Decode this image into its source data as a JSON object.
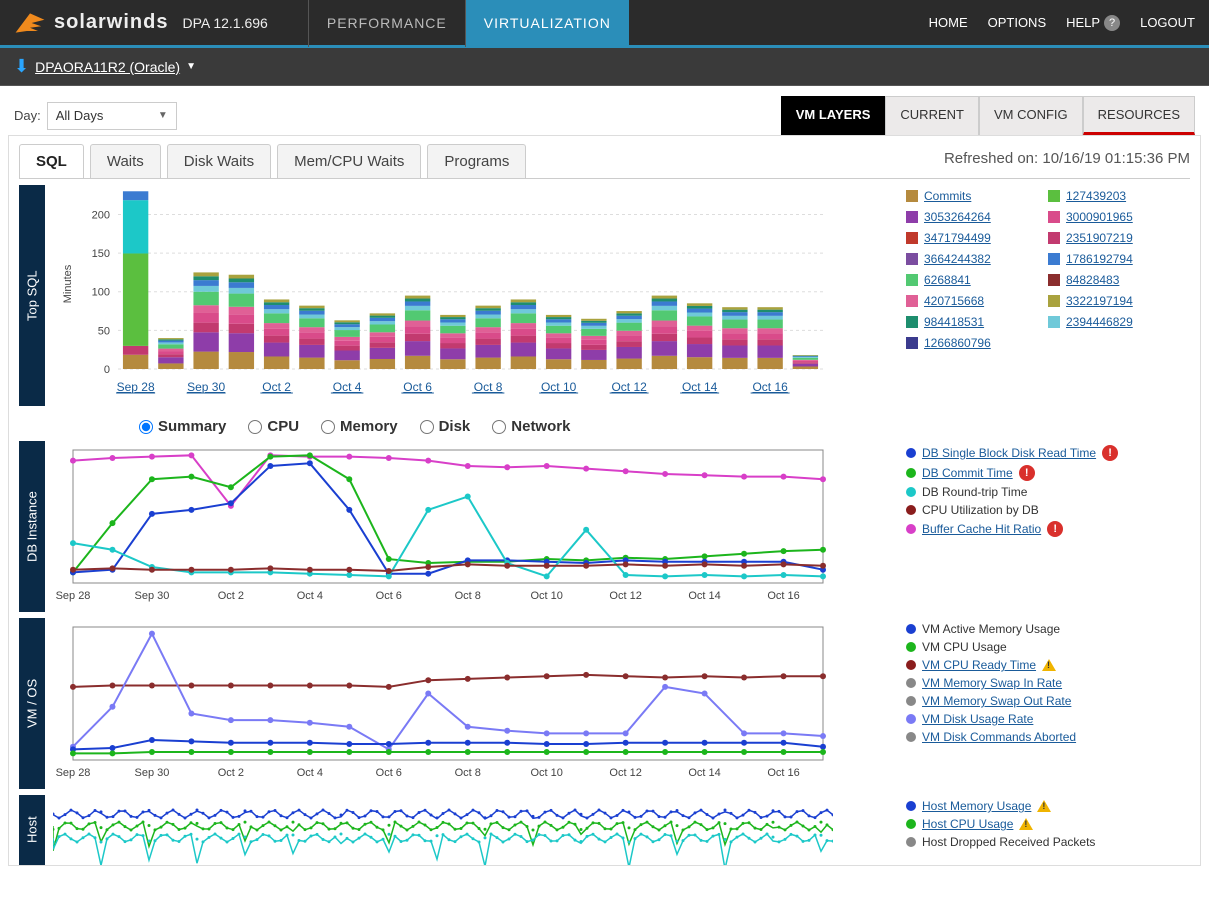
{
  "header": {
    "brand": "solarwinds",
    "product": "DPA 12.1.696",
    "nav": {
      "home": "HOME",
      "options": "OPTIONS",
      "help": "HELP",
      "logout": "LOGOUT"
    },
    "main_tabs": {
      "performance": "PERFORMANCE",
      "virtualization": "VIRTUALIZATION"
    }
  },
  "subheader": {
    "db_name": "DPAORA11R2 (Oracle)"
  },
  "toolbar": {
    "day_label": "Day:",
    "day_value": "All Days",
    "vm_tabs": {
      "layers": "VM LAYERS",
      "current": "CURRENT",
      "config": "VM CONFIG",
      "resources": "RESOURCES"
    }
  },
  "chart_tabs": {
    "sql": "SQL",
    "waits": "Waits",
    "disk_waits": "Disk Waits",
    "mem_cpu": "Mem/CPU Waits",
    "programs": "Programs"
  },
  "refreshed": {
    "label": "Refreshed on:",
    "value": "10/16/19 01:15:36 PM"
  },
  "view_radios": {
    "summary": "Summary",
    "cpu": "CPU",
    "memory": "Memory",
    "disk": "Disk",
    "network": "Network"
  },
  "panels": {
    "top_sql": "Top SQL",
    "db_instance": "DB Instance",
    "vm_os": "VM / OS",
    "host": "Host"
  },
  "top_sql_legend": [
    {
      "label": "Commits",
      "color": "#b58a3e"
    },
    {
      "label": "127439203",
      "color": "#5bbf3f"
    },
    {
      "label": "3053264264",
      "color": "#8e3da9"
    },
    {
      "label": "3000901965",
      "color": "#d94b8a"
    },
    {
      "label": "3471794499",
      "color": "#c0392b"
    },
    {
      "label": "2351907219",
      "color": "#c23a6f"
    },
    {
      "label": "3664244382",
      "color": "#7b4da0"
    },
    {
      "label": "1786192794",
      "color": "#3b7bd1"
    },
    {
      "label": "6268841",
      "color": "#52c972"
    },
    {
      "label": "84828483",
      "color": "#8a2d2d"
    },
    {
      "label": "420715668",
      "color": "#e06096"
    },
    {
      "label": "3322197194",
      "color": "#a9a23e"
    },
    {
      "label": "984418531",
      "color": "#1e8e6e"
    },
    {
      "label": "2394446829",
      "color": "#6fc9d9"
    },
    {
      "label": "1266860796",
      "color": "#3b3b8e"
    }
  ],
  "db_instance_legend": [
    {
      "label": "DB Single Block Disk Read Time",
      "color": "#1a3fd1",
      "alert": true,
      "link": true
    },
    {
      "label": "DB Commit Time",
      "color": "#1cb51c",
      "alert": true,
      "link": true
    },
    {
      "label": "DB Round-trip Time",
      "color": "#1cc8c8",
      "link": false
    },
    {
      "label": "CPU Utilization by DB",
      "color": "#8a1d1d",
      "link": false
    },
    {
      "label": "Buffer Cache Hit Ratio",
      "color": "#d83fc8",
      "alert": true,
      "link": true
    }
  ],
  "vm_os_legend": [
    {
      "label": "VM Active Memory Usage",
      "color": "#1a3fd1"
    },
    {
      "label": "VM CPU Usage",
      "color": "#1cb51c"
    },
    {
      "label": "VM CPU Ready Time",
      "color": "#8a1d1d",
      "warn": true,
      "link": true
    },
    {
      "label": "VM Memory Swap In Rate",
      "color": "#888",
      "link": true
    },
    {
      "label": "VM Memory Swap Out Rate",
      "color": "#888",
      "link": true
    },
    {
      "label": "VM Disk Usage Rate",
      "color": "#7a7af5",
      "link": true
    },
    {
      "label": "VM Disk Commands Aborted",
      "color": "#888",
      "link": true
    }
  ],
  "host_legend": [
    {
      "label": "Host Memory Usage",
      "color": "#1a3fd1",
      "warn": true,
      "link": true
    },
    {
      "label": "Host CPU Usage",
      "color": "#1cb51c",
      "warn": true,
      "link": true
    },
    {
      "label": "Host Dropped Received Packets",
      "color": "#888"
    }
  ],
  "chart_data": [
    {
      "id": "top_sql",
      "type": "bar",
      "ylabel": "Minutes",
      "ylim": [
        0,
        220
      ],
      "yticks": [
        0,
        50,
        100,
        150,
        200
      ],
      "categories": [
        "Sep 28",
        "",
        "Sep 30",
        "",
        "Oct 2",
        "",
        "Oct 4",
        "",
        "Oct 6",
        "",
        "Oct 8",
        "",
        "Oct 10",
        "",
        "Oct 12",
        "",
        "Oct 14",
        "",
        "Oct 16",
        ""
      ],
      "totals": [
        230,
        40,
        125,
        122,
        90,
        82,
        63,
        72,
        95,
        70,
        82,
        90,
        70,
        65,
        75,
        95,
        85,
        80,
        80,
        18
      ],
      "stack_spec": [
        {
          "color": "#b58a3e",
          "frac": 0.18
        },
        {
          "color": "#8e3da9",
          "frac": 0.2
        },
        {
          "color": "#c23a6f",
          "frac": 0.1
        },
        {
          "color": "#d94b8a",
          "frac": 0.1
        },
        {
          "color": "#e06096",
          "frac": 0.08
        },
        {
          "color": "#52c972",
          "frac": 0.14
        },
        {
          "color": "#6fc9d9",
          "frac": 0.06
        },
        {
          "color": "#3b7bd1",
          "frac": 0.06
        },
        {
          "color": "#1e8e6e",
          "frac": 0.04
        },
        {
          "color": "#a9a23e",
          "frac": 0.04
        }
      ],
      "first_bar_override": [
        {
          "color": "#b58a3e",
          "frac": 0.08
        },
        {
          "color": "#c23a6f",
          "frac": 0.05
        },
        {
          "color": "#5bbf3f",
          "frac": 0.52
        },
        {
          "color": "#1cc8c8",
          "frac": 0.3
        },
        {
          "color": "#3b7bd1",
          "frac": 0.05
        }
      ]
    },
    {
      "id": "db_instance",
      "type": "line",
      "categories": [
        "Sep 28",
        "Sep 30",
        "Oct 2",
        "Oct 4",
        "Oct 6",
        "Oct 8",
        "Oct 10",
        "Oct 12",
        "Oct 14",
        "Oct 16"
      ],
      "ylim": [
        0,
        100
      ],
      "series": [
        {
          "name": "Buffer Cache Hit Ratio",
          "color": "#d83fc8",
          "values": [
            92,
            94,
            95,
            96,
            58,
            96,
            95,
            95,
            94,
            92,
            88,
            87,
            88,
            86,
            84,
            82,
            81,
            80,
            80,
            78
          ]
        },
        {
          "name": "DB Commit Time",
          "color": "#1cb51c",
          "values": [
            8,
            45,
            78,
            80,
            72,
            95,
            96,
            78,
            18,
            15,
            16,
            16,
            18,
            17,
            19,
            18,
            20,
            22,
            24,
            25
          ]
        },
        {
          "name": "DB Single Block Disk Read Time",
          "color": "#1a3fd1",
          "values": [
            8,
            10,
            52,
            55,
            60,
            88,
            90,
            55,
            7,
            7,
            17,
            17,
            16,
            15,
            17,
            16,
            16,
            16,
            16,
            10
          ]
        },
        {
          "name": "DB Round-trip Time",
          "color": "#1cc8c8",
          "values": [
            30,
            25,
            12,
            8,
            8,
            8,
            7,
            6,
            5,
            55,
            65,
            15,
            5,
            40,
            6,
            5,
            6,
            5,
            6,
            5
          ]
        },
        {
          "name": "CPU Utilization by DB",
          "color": "#8a2d2d",
          "values": [
            10,
            11,
            10,
            10,
            10,
            11,
            10,
            10,
            9,
            12,
            14,
            13,
            13,
            13,
            14,
            13,
            14,
            13,
            14,
            13
          ]
        }
      ]
    },
    {
      "id": "vm_os",
      "type": "line",
      "categories": [
        "Sep 28",
        "Sep 30",
        "Oct 2",
        "Oct 4",
        "Oct 6",
        "Oct 8",
        "Oct 10",
        "Oct 12",
        "Oct 14",
        "Oct 16"
      ],
      "ylim": [
        0,
        100
      ],
      "series": [
        {
          "name": "VM CPU Ready Time",
          "color": "#8a2d2d",
          "values": [
            55,
            56,
            56,
            56,
            56,
            56,
            56,
            56,
            55,
            60,
            61,
            62,
            63,
            64,
            63,
            62,
            63,
            62,
            63,
            63
          ]
        },
        {
          "name": "VM Disk Usage Rate",
          "color": "#7a7af5",
          "values": [
            10,
            40,
            95,
            35,
            30,
            30,
            28,
            25,
            8,
            50,
            25,
            22,
            20,
            20,
            20,
            55,
            50,
            20,
            20,
            18
          ]
        },
        {
          "name": "VM Active Memory Usage",
          "color": "#1a3fd1",
          "values": [
            8,
            9,
            15,
            14,
            13,
            13,
            13,
            12,
            12,
            13,
            13,
            13,
            12,
            12,
            13,
            13,
            13,
            13,
            13,
            10
          ]
        },
        {
          "name": "VM CPU Usage",
          "color": "#1cb51c",
          "values": [
            5,
            5,
            6,
            6,
            6,
            6,
            6,
            6,
            6,
            6,
            6,
            6,
            6,
            6,
            6,
            6,
            6,
            6,
            6,
            6
          ]
        }
      ]
    }
  ]
}
